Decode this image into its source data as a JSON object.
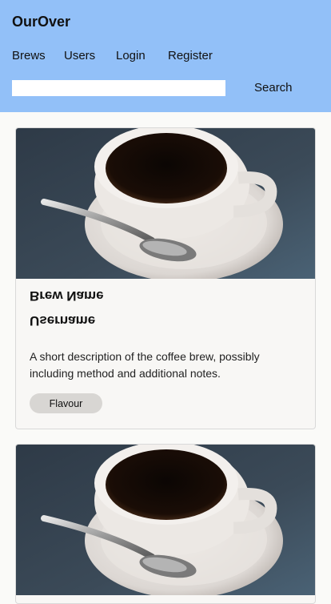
{
  "header": {
    "brand": "OurOver",
    "nav": [
      "Brews",
      "Users",
      "Login",
      "Register"
    ],
    "search": {
      "value": "",
      "placeholder": "",
      "button_label": "Search"
    }
  },
  "cards": [
    {
      "image_icon": "coffee-cup-photo",
      "brew_name": "Brew Name",
      "username": "Username",
      "description": "A short description of the coffee brew, possibly including method and additional notes.",
      "flavour_tag": "Flavour"
    },
    {
      "image_icon": "coffee-cup-photo"
    }
  ],
  "colors": {
    "header_bg": "#92c0f8",
    "page_bg": "#fafaf8",
    "card_bg": "#f8f7f5",
    "tag_bg": "#d8d6d3"
  }
}
